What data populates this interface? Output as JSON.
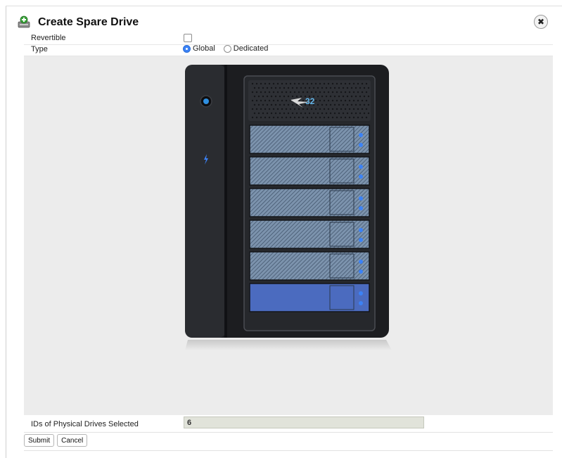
{
  "dialog": {
    "title": "Create Spare Drive",
    "header_icon": "drive-add-icon",
    "close_icon": "close-icon",
    "close_glyph": "✖"
  },
  "form": {
    "revertible": {
      "label": "Revertible",
      "checked": false
    },
    "type": {
      "label": "Type",
      "options": [
        {
          "label": "Global",
          "selected": true
        },
        {
          "label": "Dedicated",
          "selected": false
        }
      ]
    },
    "drives_selected": {
      "label": "IDs of Physical Drives Selected",
      "value": "6"
    }
  },
  "device": {
    "image": "pegasus-raid-enclosure",
    "badge": "32",
    "bays": 6,
    "selected_bay": 6,
    "colors": {
      "accent": "#3b82f6",
      "bay": "#7c93ad",
      "selected_bay": "#4b6bbf"
    }
  },
  "actions": {
    "submit_label": "Submit",
    "cancel_label": "Cancel"
  }
}
